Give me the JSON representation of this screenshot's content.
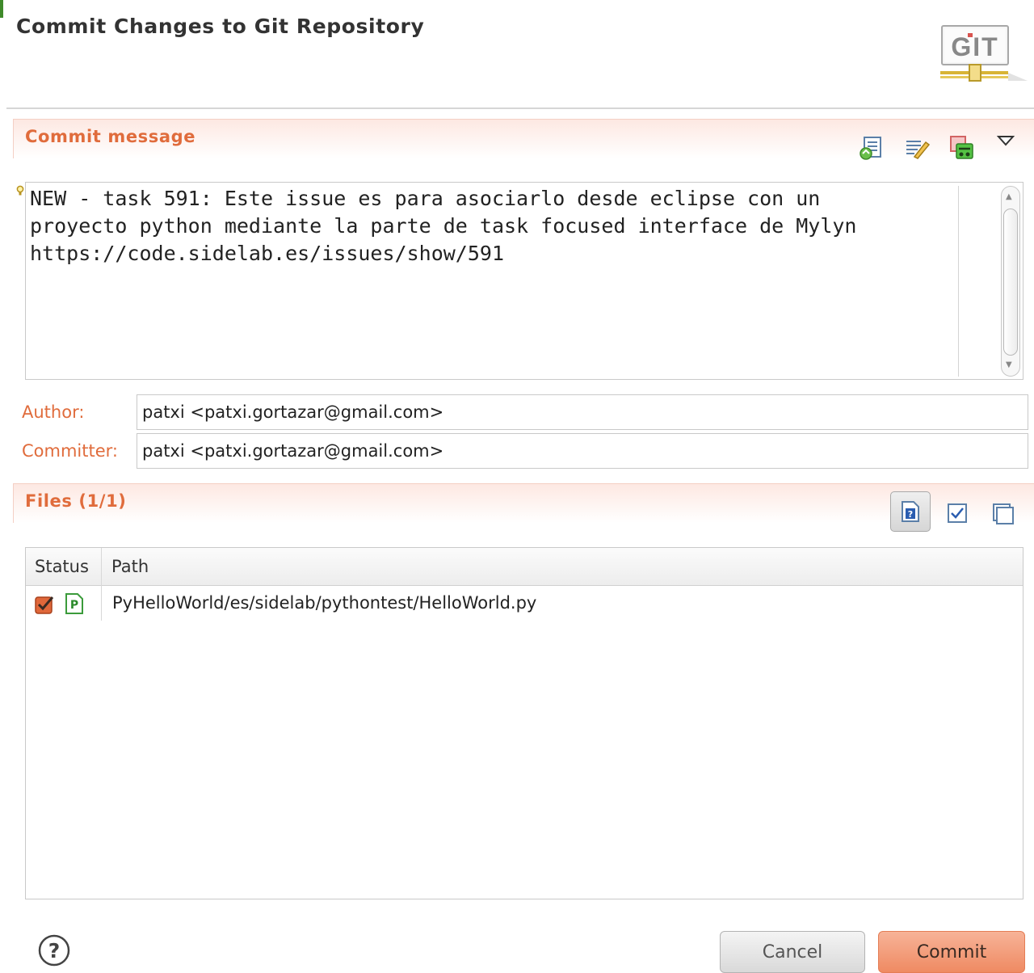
{
  "dialog": {
    "title": "Commit Changes to Git Repository",
    "logo_text": "GIT"
  },
  "commit_section": {
    "title": "Commit message",
    "toolbar": [
      "previous-messages-icon",
      "signed-off-by-icon",
      "amend-commit-icon",
      "view-menu-icon"
    ],
    "message": "NEW - task 591: Este issue es para asociarlo desde eclipse con un\nproyecto python mediante la parte de task focused interface de Mylyn\nhttps://code.sidelab.es/issues/show/591"
  },
  "author": {
    "label": "Author:",
    "value": "patxi <patxi.gortazar@gmail.com>"
  },
  "committer": {
    "label": "Committer:",
    "value": "patxi <patxi.gortazar@gmail.com>"
  },
  "files_section": {
    "title": "Files (1/1)",
    "toolbar": [
      "show-untracked-icon",
      "select-all-icon",
      "deselect-all-icon"
    ],
    "columns": {
      "status": "Status",
      "path": "Path"
    },
    "rows": [
      {
        "checked": true,
        "file_type": "python-file-icon",
        "path": "PyHelloWorld/es/sidelab/pythontest/HelloWorld.py"
      }
    ]
  },
  "buttons": {
    "cancel": "Cancel",
    "commit": "Commit"
  },
  "colors": {
    "accent": "#e06c3c",
    "commit_button": "#ef8a62"
  }
}
